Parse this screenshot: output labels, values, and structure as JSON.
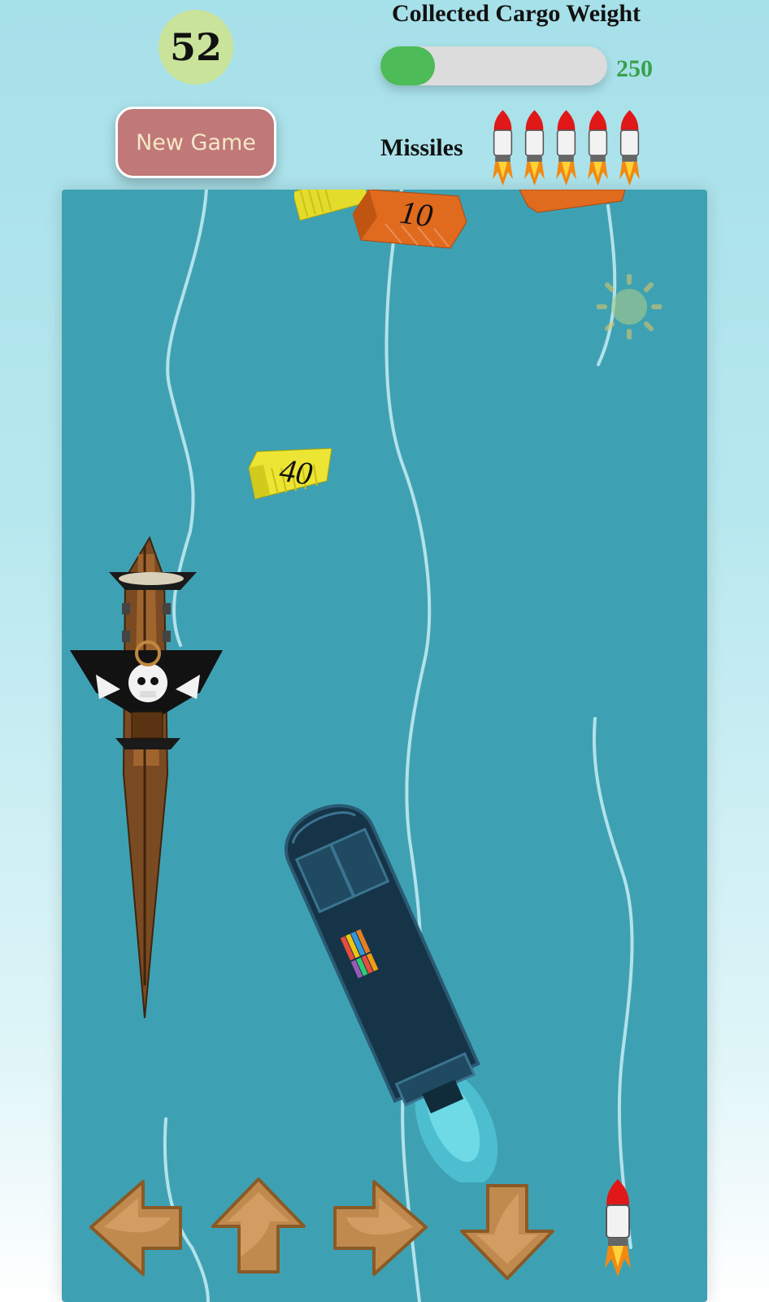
{
  "hud": {
    "score": "52",
    "new_game_label": "New Game",
    "cargo_title": "Collected Cargo Weight",
    "cargo_progress": 0.24,
    "cargo_value": "250",
    "missiles_label": "Missiles",
    "missiles_count": 5
  },
  "colors": {
    "score_badge": "#c9e39a",
    "button": "#c07878",
    "progress_fill": "#4dbb57",
    "water": "#3ea1b3",
    "cargo_value": "#3aa04a"
  },
  "board": {
    "containers": [
      {
        "color": "yellow",
        "label": ""
      },
      {
        "color": "orange",
        "label": "10"
      },
      {
        "color": "orange",
        "label": ""
      },
      {
        "color": "yellow",
        "label": "40"
      }
    ],
    "icons": [
      "sun-icon",
      "pirate-ship",
      "cargo-ship"
    ]
  },
  "controls": [
    "arrow-left-icon",
    "arrow-up-icon",
    "arrow-right-icon",
    "arrow-down-icon",
    "fire-missile-icon"
  ]
}
